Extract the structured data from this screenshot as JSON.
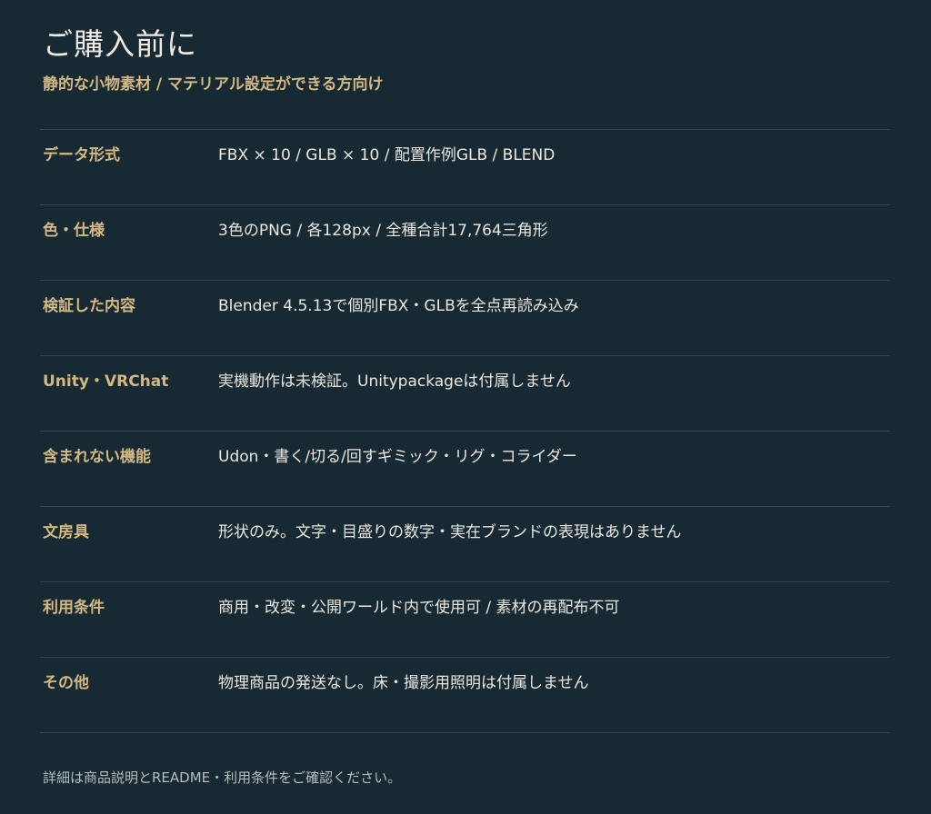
{
  "header": {
    "title": "ご購入前に",
    "subtitle": "静的な小物素材 / マテリアル設定ができる方向け"
  },
  "specs": [
    {
      "label": "データ形式",
      "value": "FBX × 10 / GLB × 10 / 配置作例GLB / BLEND"
    },
    {
      "label": "色・仕様",
      "value": "3色のPNG / 各128px / 全種合計17,764三角形"
    },
    {
      "label": "検証した内容",
      "value": "Blender 4.5.13で個別FBX・GLBを全点再読み込み"
    },
    {
      "label": "Unity・VRChat",
      "value": "実機動作は未検証。Unitypackageは付属しません"
    },
    {
      "label": "含まれない機能",
      "value": "Udon・書く/切る/回すギミック・リグ・コライダー"
    },
    {
      "label": "文房具",
      "value": "形状のみ。文字・目盛りの数字・実在ブランドの表現はありません"
    },
    {
      "label": "利用条件",
      "value": "商用・改変・公開ワールド内で使用可 / 素材の再配布不可"
    },
    {
      "label": "その他",
      "value": "物理商品の発送なし。床・撮影用照明は付属しません"
    }
  ],
  "footer": {
    "note": "詳細は商品説明とREADME・利用条件をご確認ください。"
  }
}
